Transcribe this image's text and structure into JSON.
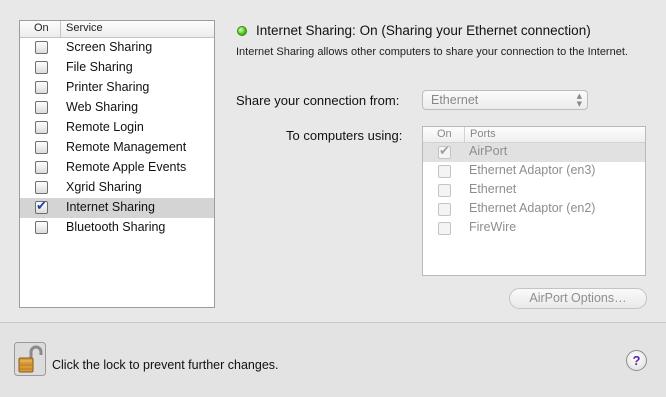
{
  "services": {
    "header_on": "On",
    "header_service": "Service",
    "items": [
      {
        "label": "Screen Sharing",
        "checked": false
      },
      {
        "label": "File Sharing",
        "checked": false
      },
      {
        "label": "Printer Sharing",
        "checked": false
      },
      {
        "label": "Web Sharing",
        "checked": false
      },
      {
        "label": "Remote Login",
        "checked": false
      },
      {
        "label": "Remote Management",
        "checked": false
      },
      {
        "label": "Remote Apple Events",
        "checked": false
      },
      {
        "label": "Xgrid Sharing",
        "checked": false
      },
      {
        "label": "Internet Sharing",
        "checked": true,
        "selected": true
      },
      {
        "label": "Bluetooth Sharing",
        "checked": false
      }
    ]
  },
  "status": {
    "title": "Internet Sharing: On (Sharing your Ethernet connection)",
    "description": "Internet Sharing allows other computers to share your connection to the Internet.",
    "color": "#4ccb1c"
  },
  "share_from": {
    "label": "Share your connection from:",
    "value": "Ethernet"
  },
  "ports": {
    "label": "To computers using:",
    "header_on": "On",
    "header_ports": "Ports",
    "items": [
      {
        "label": "AirPort",
        "checked": true,
        "selected": true
      },
      {
        "label": "Ethernet Adaptor (en3)",
        "checked": false
      },
      {
        "label": "Ethernet",
        "checked": false
      },
      {
        "label": "Ethernet Adaptor (en2)",
        "checked": false
      },
      {
        "label": "FireWire",
        "checked": false
      }
    ]
  },
  "airport_options_label": "AirPort Options…",
  "lock": {
    "label": "Click the lock to prevent further changes.",
    "icon": "lock-icon"
  },
  "help": {
    "label": "?",
    "icon": "help-icon"
  }
}
